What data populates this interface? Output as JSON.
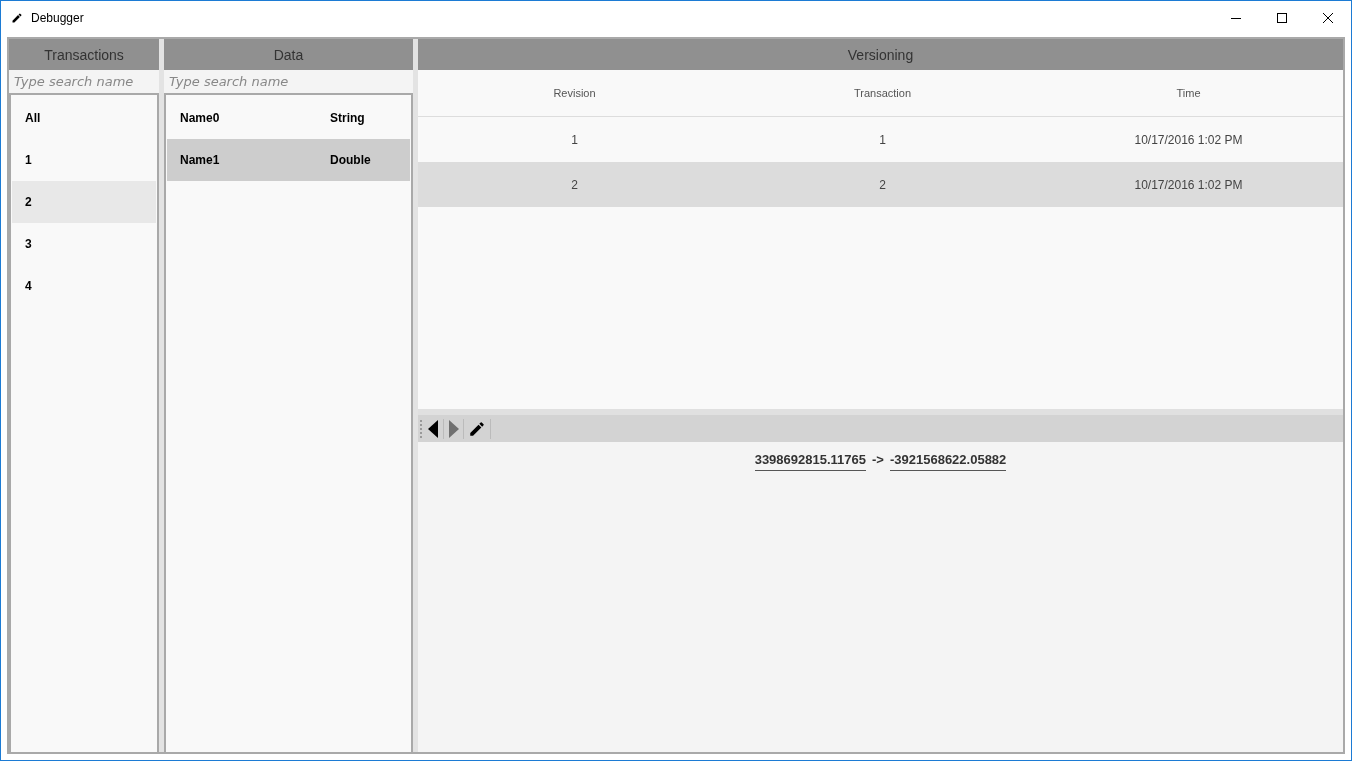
{
  "window": {
    "title": "Debugger"
  },
  "transactions": {
    "header": "Transactions",
    "search": {
      "placeholder": "Type search name"
    },
    "items": [
      {
        "label": "All",
        "selected": false
      },
      {
        "label": "1",
        "selected": false
      },
      {
        "label": "2",
        "selected": true
      },
      {
        "label": "3",
        "selected": false
      },
      {
        "label": "4",
        "selected": false
      }
    ]
  },
  "data": {
    "header": "Data",
    "search": {
      "placeholder": "Type search name"
    },
    "items": [
      {
        "name": "Name0",
        "type": "String",
        "selected": false
      },
      {
        "name": "Name1",
        "type": "Double",
        "selected": true
      }
    ]
  },
  "versioning": {
    "header": "Versioning",
    "columns": [
      "Revision",
      "Transaction",
      "Time"
    ],
    "rows": [
      {
        "cells": [
          "1",
          "1",
          "10/17/2016 1:02 PM"
        ],
        "selected": false
      },
      {
        "cells": [
          "2",
          "2",
          "10/17/2016 1:02 PM"
        ],
        "selected": true
      }
    ],
    "change": {
      "old_value": "3398692815.11765",
      "arrow": "->",
      "new_value": "-3921568622.05882"
    }
  }
}
